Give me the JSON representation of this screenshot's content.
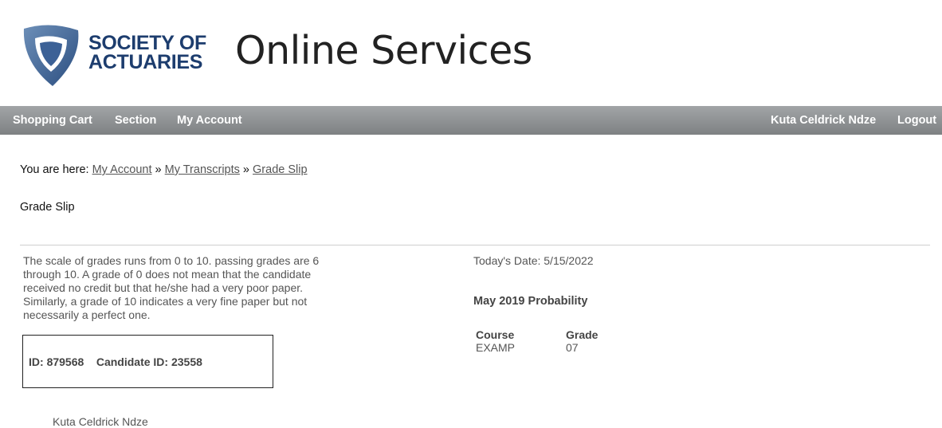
{
  "header": {
    "logo_line1": "SOCIETY OF",
    "logo_line2": "ACTUARIES",
    "site_title": "Online Services",
    "brand_color": "#1d3d6e",
    "logo_icon": "shield-icon"
  },
  "nav": {
    "shopping_cart": "Shopping Cart",
    "section": "Section",
    "my_account": "My Account",
    "user_name": "Kuta Celdrick Ndze",
    "logout": "Logout"
  },
  "breadcrumb": {
    "prefix": "You are here: ",
    "items": [
      "My Account",
      "My Transcripts",
      "Grade Slip"
    ],
    "separator": " » "
  },
  "page_title": "Grade Slip",
  "scale_text": "The scale of grades runs from 0 to 10. passing grades are 6 through 10. A grade of 0 does not mean that the candidate received no credit but that he/she had a very poor paper. Similarly, a grade of 10 indicates a very fine paper but not necessarily a perfect one.",
  "ids": {
    "id_label": "ID:",
    "id_value": "879568",
    "candidate_label": "Candidate ID:",
    "candidate_value": "23558"
  },
  "candidate_name": "Kuta Celdrick Ndze",
  "today": "Today's Date: 5/15/2022",
  "exam_title": "May 2019 Probability",
  "grades": {
    "headers": [
      "Course",
      "Grade"
    ],
    "rows": [
      [
        "EXAMP",
        "07"
      ]
    ]
  }
}
